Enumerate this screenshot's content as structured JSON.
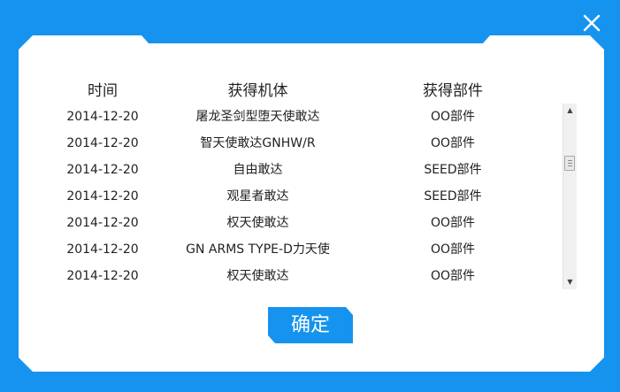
{
  "dialog": {
    "close_icon": "close-icon",
    "confirm_label": "确定"
  },
  "table": {
    "headers": [
      "时间",
      "获得机体",
      "获得部件"
    ],
    "rows": [
      {
        "time": "2014-12-20",
        "mecha": "屠龙圣剑型堕天使敢达",
        "part": "OO部件"
      },
      {
        "time": "2014-12-20",
        "mecha": "智天使敢达GNHW/R",
        "part": "OO部件"
      },
      {
        "time": "2014-12-20",
        "mecha": "自由敢达",
        "part": "SEED部件"
      },
      {
        "time": "2014-12-20",
        "mecha": "观星者敢达",
        "part": "SEED部件"
      },
      {
        "time": "2014-12-20",
        "mecha": "权天使敢达",
        "part": "OO部件"
      },
      {
        "time": "2014-12-20",
        "mecha": "GN ARMS TYPE-D力天使",
        "part": "OO部件"
      },
      {
        "time": "2014-12-20",
        "mecha": "权天使敢达",
        "part": "OO部件"
      }
    ]
  },
  "scrollbar": {
    "up_arrow": "▲",
    "down_arrow": "▼"
  },
  "colors": {
    "accent": "#1593ee",
    "panel": "#ffffff",
    "text": "#222222"
  }
}
